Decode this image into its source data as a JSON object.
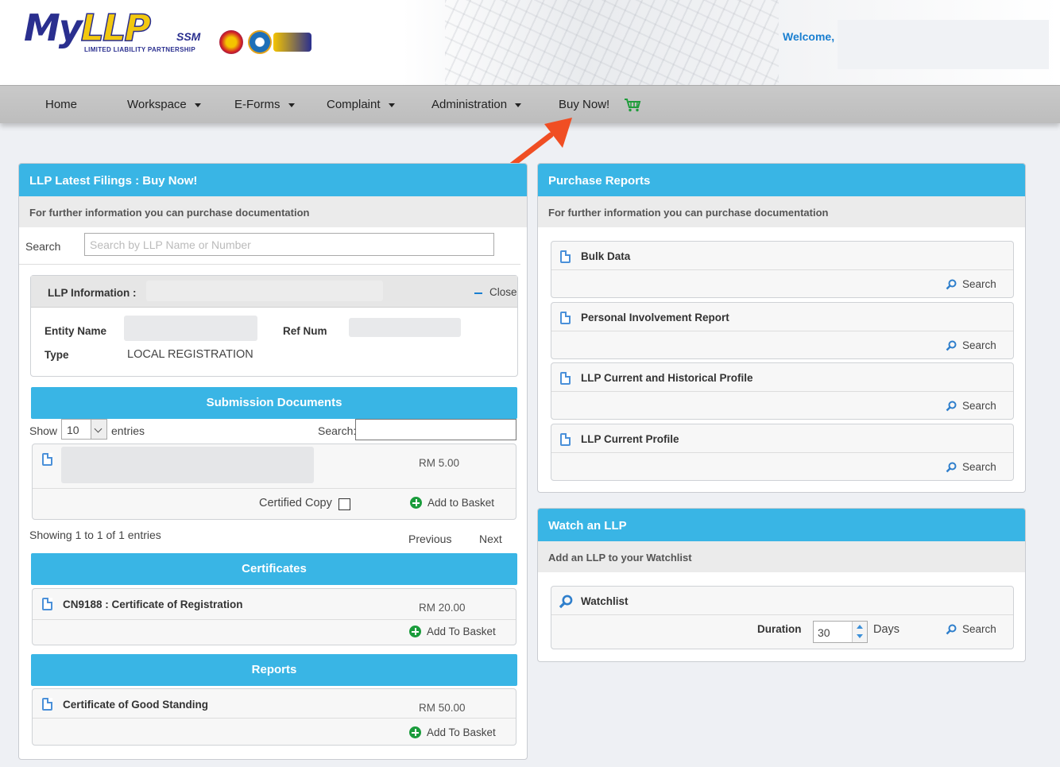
{
  "header": {
    "logo": {
      "main": "MyLLP",
      "ssm": "SSM",
      "subtitle": "LIMITED LIABILITY PARTNERSHIP"
    },
    "welcome": "Welcome,"
  },
  "nav": {
    "items": [
      {
        "label": "Home"
      },
      {
        "label": "Workspace"
      },
      {
        "label": "E-Forms"
      },
      {
        "label": "Complaint"
      },
      {
        "label": "Administration"
      },
      {
        "label": "Buy Now!"
      }
    ],
    "cart_icon": "shopping-cart-icon"
  },
  "annotation": {
    "arrow_color": "#f04e23"
  },
  "left_panel": {
    "title": "LLP Latest Filings : Buy Now!",
    "subtitle": "For further information you can purchase documentation",
    "search_label": "Search",
    "search_placeholder": "Search by LLP Name or Number",
    "info": {
      "title": "LLP Information :",
      "close": "Close",
      "entity_name_label": "Entity Name",
      "ref_num_label": "Ref Num",
      "type_label": "Type",
      "type_value": "LOCAL REGISTRATION"
    },
    "submission": {
      "title": "Submission Documents",
      "show": "Show",
      "entries_count": "10",
      "entries": "entries",
      "search": "Search:",
      "price": "RM 5.00",
      "certified_copy": "Certified Copy",
      "add_to_basket": "Add to Basket",
      "showing": "Showing 1 to 1 of 1 entries",
      "previous": "Previous",
      "next": "Next"
    },
    "certificates": {
      "title": "Certificates",
      "item": "CN9188 : Certificate of Registration",
      "price": "RM 20.00",
      "add": "Add To Basket"
    },
    "reports": {
      "title": "Reports",
      "item": "Certificate of Good Standing",
      "price": "RM 50.00",
      "add": "Add To Basket"
    }
  },
  "purchase_reports": {
    "title": "Purchase Reports",
    "subtitle": "For further information you can purchase documentation",
    "search_label": "Search",
    "items": [
      {
        "title": "Bulk Data"
      },
      {
        "title": "Personal Involvement Report"
      },
      {
        "title": "LLP Current and Historical Profile"
      },
      {
        "title": "LLP Current Profile"
      }
    ]
  },
  "watch": {
    "title": "Watch an LLP",
    "subtitle": "Add an LLP to your Watchlist",
    "watchlist": "Watchlist",
    "duration_label": "Duration",
    "duration_value": "30",
    "days": "Days",
    "search": "Search"
  }
}
